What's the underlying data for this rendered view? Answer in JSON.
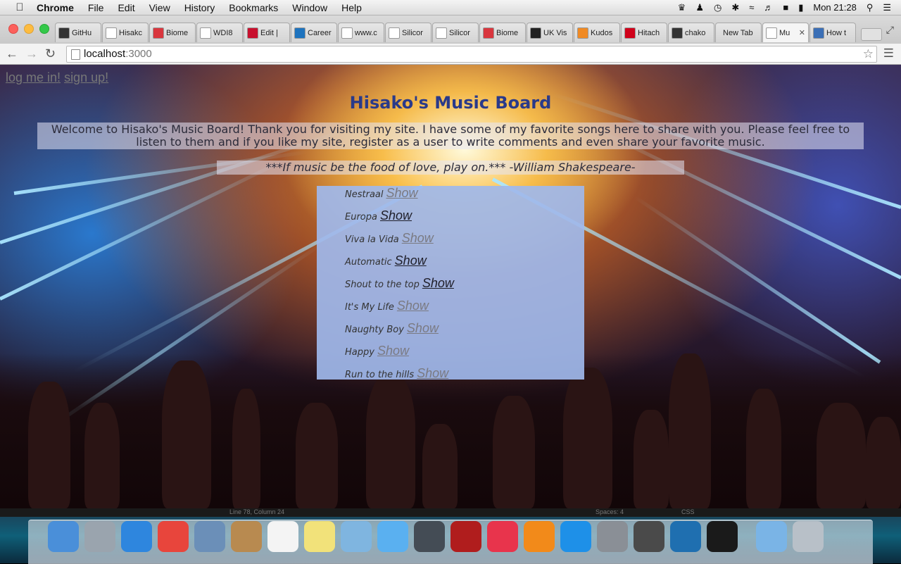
{
  "menubar": {
    "apple_icon": "apple-icon",
    "app_name": "Chrome",
    "items": [
      "File",
      "Edit",
      "View",
      "History",
      "Bookmarks",
      "Window",
      "Help"
    ],
    "clock": "Mon 21:28",
    "status_icons": [
      "evernote-icon",
      "notification-icon",
      "time-machine-icon",
      "bluetooth-icon",
      "wifi-icon",
      "volume-icon",
      "flag-uk-icon",
      "battery-icon",
      "spotlight-icon",
      "list-icon"
    ]
  },
  "tabs": [
    {
      "label": "GitHu",
      "icon": "github-icon",
      "color": "#333333"
    },
    {
      "label": "Hisakc",
      "icon": "page-icon",
      "color": "#ffffff"
    },
    {
      "label": "Biome",
      "icon": "biome-icon",
      "color": "#d9363e"
    },
    {
      "label": "WDI8",
      "icon": "gmail-icon",
      "color": "#ffffff"
    },
    {
      "label": "Edit |",
      "icon": "edit-icon",
      "color": "#c8102e"
    },
    {
      "label": "Career",
      "icon": "ie-icon",
      "color": "#1e73be"
    },
    {
      "label": "www.c",
      "icon": "page-icon",
      "color": "#ffffff"
    },
    {
      "label": "Silicor",
      "icon": "silicon-icon",
      "color": "#ffffff"
    },
    {
      "label": "Silicor",
      "icon": "silicon-icon",
      "color": "#ffffff"
    },
    {
      "label": "Biome",
      "icon": "biome-icon",
      "color": "#d9363e"
    },
    {
      "label": "UK Vis",
      "icon": "ukvisa-icon",
      "color": "#222222"
    },
    {
      "label": "Kudos",
      "icon": "kudos-icon",
      "color": "#f08a24"
    },
    {
      "label": "Hitach",
      "icon": "hitachi-icon",
      "color": "#d0021b"
    },
    {
      "label": "chako",
      "icon": "github-icon",
      "color": "#333333"
    },
    {
      "label": "New Tab",
      "icon": "",
      "color": ""
    },
    {
      "label": "Mu",
      "icon": "page-icon",
      "color": "#ffffff",
      "active": true
    },
    {
      "label": "How t",
      "icon": "howto-icon",
      "color": "#3b6fb6"
    }
  ],
  "toolbar": {
    "url_host": "localhost",
    "url_port": ":3000"
  },
  "page": {
    "login": "log me in!",
    "signup": "sign up!",
    "title": "Hisako's Music Board",
    "welcome": "Welcome to Hisako's Music Board! Thank you for visiting my site. I have some of my favorite songs here to share with you. Please feel free to listen to them and if you like my site, register as a user to write comments and even share your favorite music.",
    "quote": "***If music be the food of love, play on.*** -William Shakespeare-",
    "songs": [
      {
        "name": "Nestraal",
        "link": "Show",
        "link_color": "#7a7a82"
      },
      {
        "name": "Europa",
        "link": "Show",
        "link_color": "#1f1f2a"
      },
      {
        "name": "Viva la Vida",
        "link": "Show",
        "link_color": "#7a7a82"
      },
      {
        "name": "Automatic",
        "link": "Show",
        "link_color": "#1f1f2a"
      },
      {
        "name": "Shout to the top",
        "link": "Show",
        "link_color": "#1f1f2a"
      },
      {
        "name": "It's My Life",
        "link": "Show",
        "link_color": "#7a7a82"
      },
      {
        "name": "Naughty Boy",
        "link": "Show",
        "link_color": "#7a7a82"
      },
      {
        "name": "Happy",
        "link": "Show",
        "link_color": "#7a7a82"
      },
      {
        "name": "Run to the hills",
        "link": "Show",
        "link_color": "#7a7a82"
      }
    ]
  },
  "editor_status": {
    "position": "Line 78, Column 24",
    "spaces": "Spaces: 4",
    "syntax": "CSS"
  },
  "dock": [
    {
      "name": "finder-icon",
      "color": "#4a8fd9"
    },
    {
      "name": "launchpad-icon",
      "color": "#9aa4ae"
    },
    {
      "name": "safari-icon",
      "color": "#2e86de"
    },
    {
      "name": "chrome-icon",
      "color": "#e8453c"
    },
    {
      "name": "mail-icon",
      "color": "#6b8fb8"
    },
    {
      "name": "contacts-icon",
      "color": "#b88a50"
    },
    {
      "name": "calendar-icon",
      "color": "#f4f4f4"
    },
    {
      "name": "notes-icon",
      "color": "#f2e27a"
    },
    {
      "name": "preview-icon",
      "color": "#7fb5e0"
    },
    {
      "name": "messages-icon",
      "color": "#5ab0f0"
    },
    {
      "name": "facetime-icon",
      "color": "#444c55"
    },
    {
      "name": "photobooth-icon",
      "color": "#b01d1d"
    },
    {
      "name": "itunes-icon",
      "color": "#e8344c"
    },
    {
      "name": "ibooks-icon",
      "color": "#f28a1a"
    },
    {
      "name": "app-store-icon",
      "color": "#1e90e8"
    },
    {
      "name": "system-preferences-icon",
      "color": "#8a8f96"
    },
    {
      "name": "sublime-text-icon",
      "color": "#4a4a4a"
    },
    {
      "name": "hipchat-icon",
      "color": "#1f6fb0"
    },
    {
      "name": "terminal-icon",
      "color": "#1a1a1a"
    },
    {
      "name": "folder-icon",
      "color": "#7ab4e6"
    },
    {
      "name": "trash-icon",
      "color": "#b8c0c8"
    }
  ]
}
